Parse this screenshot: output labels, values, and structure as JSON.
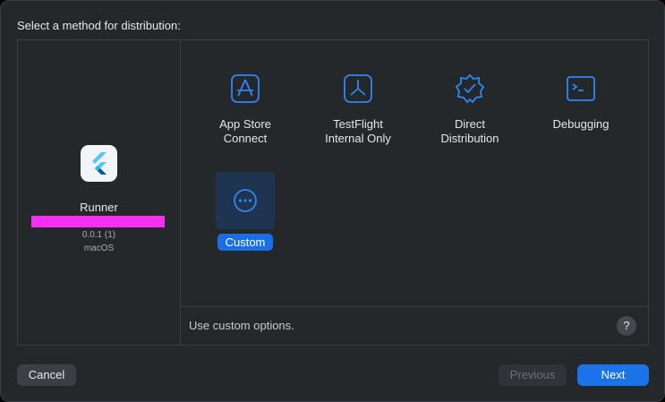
{
  "heading": "Select a method for distribution:",
  "app": {
    "name": "Runner",
    "version": "0.0.1 (1)",
    "platform": "macOS"
  },
  "options": [
    {
      "label": "App Store\nConnect",
      "icon": "app-store-icon"
    },
    {
      "label": "TestFlight\nInternal Only",
      "icon": "testflight-icon"
    },
    {
      "label": "Direct\nDistribution",
      "icon": "verified-badge-icon"
    },
    {
      "label": "Debugging",
      "icon": "terminal-icon"
    },
    {
      "label": "Custom",
      "icon": "ellipsis-icon",
      "selected": true
    }
  ],
  "description": "Use custom options.",
  "help_label": "?",
  "buttons": {
    "cancel": "Cancel",
    "previous": "Previous",
    "next": "Next"
  },
  "colors": {
    "accent": "#1a73e8",
    "icon_blue": "#2f86f5",
    "redaction": "#f72ff1"
  }
}
